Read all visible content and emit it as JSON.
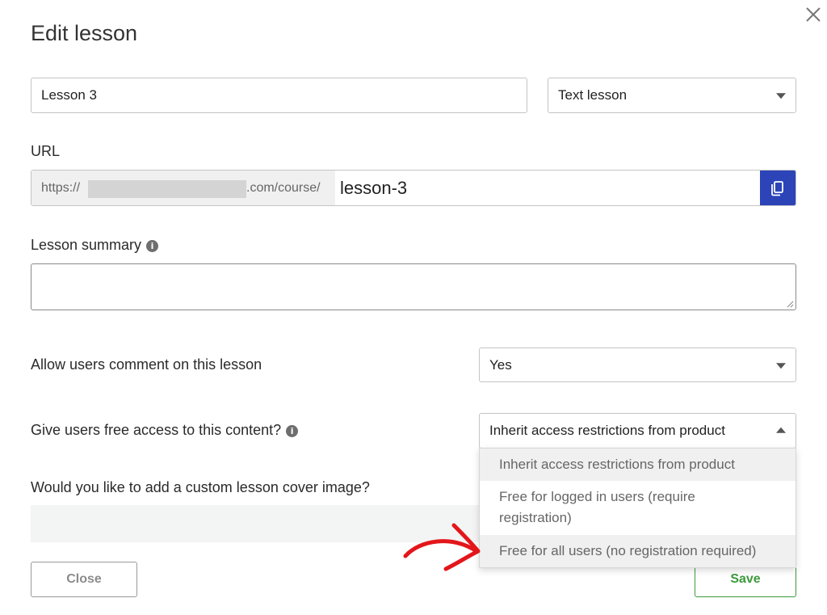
{
  "modal": {
    "title": "Edit lesson",
    "close_icon": "close-icon"
  },
  "lesson": {
    "name_value": "Lesson 3",
    "type_selected": "Text lesson"
  },
  "url": {
    "label": "URL",
    "prefix_start": "https://",
    "prefix_end": ".com/course/",
    "slug": "lesson-3",
    "copy_icon": "copy-icon",
    "copy_button_color": "#2c44b8"
  },
  "summary": {
    "label": "Lesson summary",
    "info_icon": "info-icon",
    "value": ""
  },
  "comments": {
    "label": "Allow users comment on this lesson",
    "selected": "Yes"
  },
  "free_access": {
    "label": "Give users free access to this content?",
    "info_icon": "info-icon",
    "selected": "Inherit access restrictions from product",
    "options": [
      "Inherit access restrictions from product",
      "Free for logged in users (require registration)",
      "Free for all users (no registration required)"
    ]
  },
  "cover": {
    "label": "Would you like to add a custom lesson cover image?"
  },
  "footer": {
    "close_label": "Close",
    "save_label": "Save",
    "save_color": "#3c9a3c"
  },
  "annotation": {
    "arrow_color": "#e3161b"
  }
}
